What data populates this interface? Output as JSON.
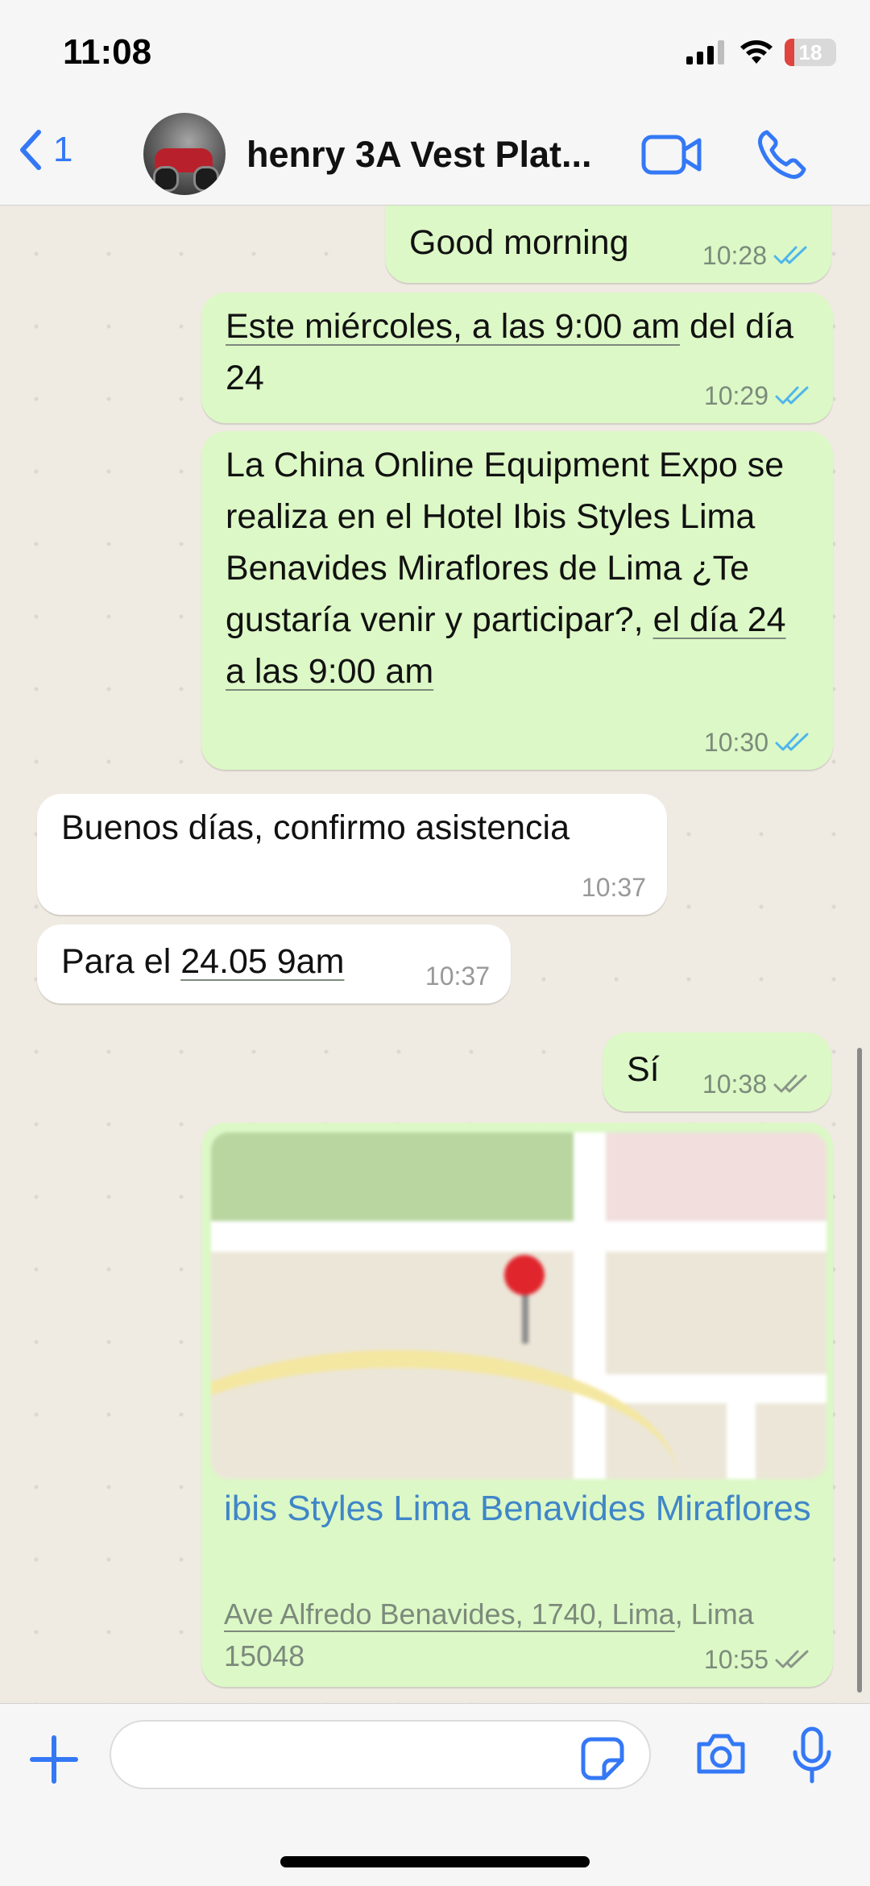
{
  "status_bar": {
    "time": "11:08",
    "battery": "18",
    "battery_level": 0.18
  },
  "header": {
    "back_count": "1",
    "contact_name": "henry 3A Vest Plat...",
    "icons": {
      "back": "chevron-left-icon",
      "video": "video-camera-icon",
      "call": "phone-icon"
    }
  },
  "messages": [
    {
      "dir": "out",
      "text": "Good morning",
      "time": "10:28",
      "status": "read"
    },
    {
      "dir": "out",
      "text_link": "Este miércoles, a las 9:00 am",
      "text_rest": " del día 24",
      "time": "10:29",
      "status": "read"
    },
    {
      "dir": "out",
      "text_plain": "La China Online Equipment Expo se realiza en el Hotel Ibis Styles Lima Benavides Miraflores de Lima ¿Te gustaría venir y participar?, ",
      "text_link": "el día 24 a las 9:00 am",
      "time": "10:30",
      "status": "read"
    },
    {
      "dir": "in",
      "text": "Buenos días, confirmo asistencia",
      "time": "10:37"
    },
    {
      "dir": "in",
      "text_plain": "Para el ",
      "text_link": "24.05 9am",
      "time": "10:37"
    },
    {
      "dir": "out",
      "text": "Sí",
      "time": "10:38",
      "status": "delivered"
    },
    {
      "dir": "out",
      "type": "location",
      "place": "ibis Styles Lima Benavides Miraflores",
      "address_link": "Ave Alfredo Benavides, 1740, Lima",
      "address_rest": ", Lima 15048",
      "time": "10:55",
      "status": "delivered"
    }
  ],
  "input": {
    "placeholder": "",
    "icons": {
      "attach": "plus-icon",
      "sticker": "sticker-icon",
      "camera": "camera-icon",
      "mic": "microphone-icon"
    }
  },
  "colors": {
    "accent": "#3478f6",
    "outgoing": "#dcf8c6",
    "incoming": "#ffffff",
    "read_ticks": "#4fb6ec",
    "delivered_ticks": "#8a958a"
  }
}
